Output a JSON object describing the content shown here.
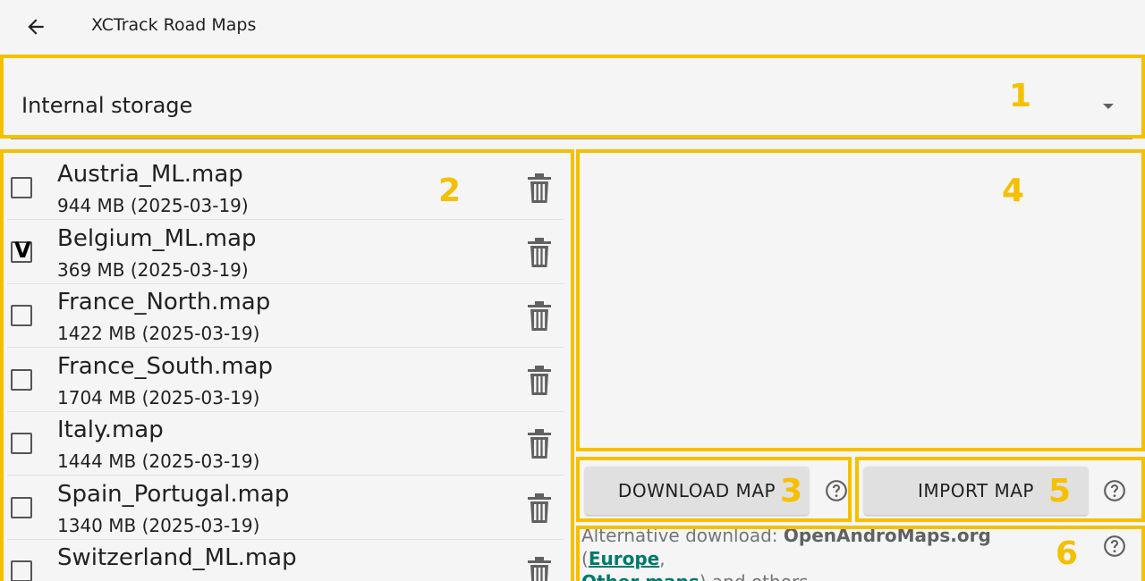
{
  "appbar": {
    "title": "XCTrack Road Maps",
    "back_icon": "arrow-left-icon"
  },
  "storage": {
    "selected": "Internal storage",
    "arrow_icon": "dropdown-arrow-icon"
  },
  "maps": [
    {
      "name": "Austria_ML.map",
      "size": "944 MB (2025-03-19)",
      "checked": false
    },
    {
      "name": "Belgium_ML.map",
      "size": "369 MB (2025-03-19)",
      "checked": true
    },
    {
      "name": "France_North.map",
      "size": "1422 MB (2025-03-19)",
      "checked": false
    },
    {
      "name": "France_South.map",
      "size": "1704 MB (2025-03-19)",
      "checked": false
    },
    {
      "name": "Italy.map",
      "size": "1444 MB (2025-03-19)",
      "checked": false
    },
    {
      "name": "Spain_Portugal.map",
      "size": "1340 MB (2025-03-19)",
      "checked": false
    },
    {
      "name": "Switzerland_ML.map",
      "size": "",
      "checked": false
    }
  ],
  "checkmark_glyph": "V",
  "buttons": {
    "download": "DOWNLOAD MAP",
    "import": "IMPORT MAP"
  },
  "footer": {
    "prefix": "Alternative download: ",
    "site": "OpenAndroMaps.org",
    "open_paren": " (",
    "europe_link": "Europe",
    "comma": ",",
    "other_link": "Other maps",
    "suffix": ") and others."
  },
  "annotations": [
    "1",
    "2",
    "3",
    "4",
    "5",
    "6"
  ],
  "colors": {
    "annotation": "#f5c000",
    "link": "#00796b",
    "button": "#e0e0e0"
  }
}
